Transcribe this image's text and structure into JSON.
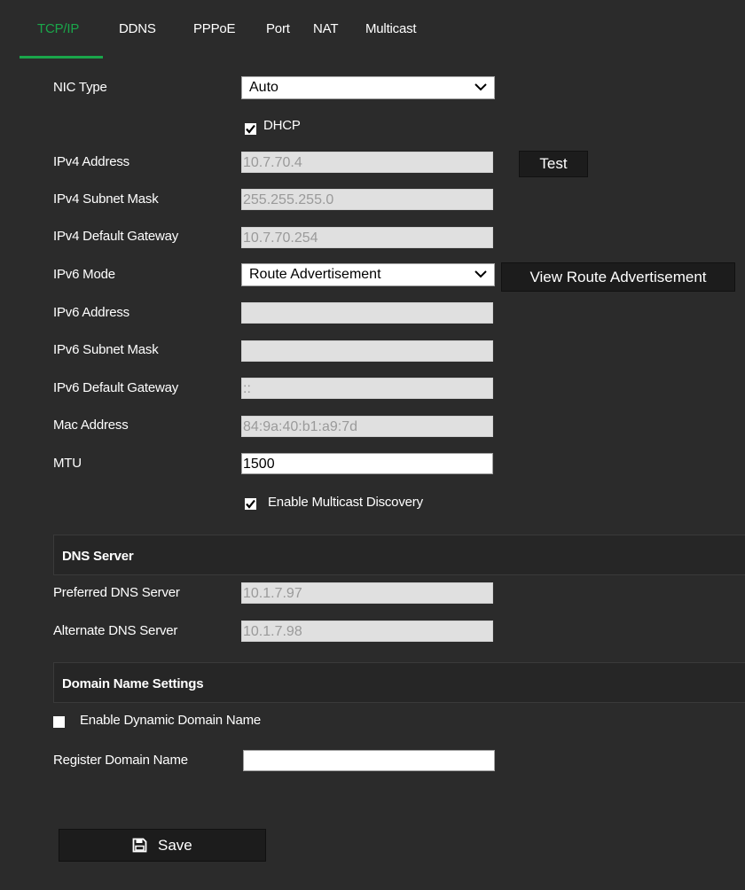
{
  "tabs": {
    "tcpip": "TCP/IP",
    "ddns": "DDNS",
    "pppoe": "PPPoE",
    "port": "Port",
    "nat": "NAT",
    "multicast": "Multicast"
  },
  "form": {
    "nic_type_label": "NIC Type",
    "nic_type_value": "Auto",
    "dhcp_label": "DHCP",
    "dhcp_checked": true,
    "ipv4_address_label": "IPv4 Address",
    "ipv4_address_value": "10.7.70.4",
    "test_button": "Test",
    "ipv4_subnet_label": "IPv4 Subnet Mask",
    "ipv4_subnet_value": "255.255.255.0",
    "ipv4_gateway_label": "IPv4 Default Gateway",
    "ipv4_gateway_value": "10.7.70.254",
    "ipv6_mode_label": "IPv6 Mode",
    "ipv6_mode_value": "Route Advertisement",
    "view_route_button": "View Route Advertisement",
    "ipv6_address_label": "IPv6 Address",
    "ipv6_address_value": "",
    "ipv6_subnet_label": "IPv6 Subnet Mask",
    "ipv6_subnet_value": "",
    "ipv6_gateway_label": "IPv6 Default Gateway",
    "ipv6_gateway_value": "::",
    "mac_label": "Mac Address",
    "mac_value": "84:9a:40:b1:a9:7d",
    "mtu_label": "MTU",
    "mtu_value": "1500",
    "multicast_discovery_label": "Enable Multicast Discovery",
    "multicast_discovery_checked": true
  },
  "dns": {
    "section_title": "DNS Server",
    "preferred_label": "Preferred DNS Server",
    "preferred_value": "10.1.7.97",
    "alternate_label": "Alternate DNS Server",
    "alternate_value": "10.1.7.98"
  },
  "domain": {
    "section_title": "Domain Name Settings",
    "enable_dynamic_label": "Enable Dynamic Domain Name",
    "enable_dynamic_checked": false,
    "register_label": "Register Domain Name",
    "register_value": ""
  },
  "save": {
    "label": "Save",
    "icon": "save-icon"
  },
  "colors": {
    "accent": "#1aa64a",
    "background": "#2b2b2b",
    "section_background": "#262626",
    "field_disabled": "#e0e0e0"
  }
}
